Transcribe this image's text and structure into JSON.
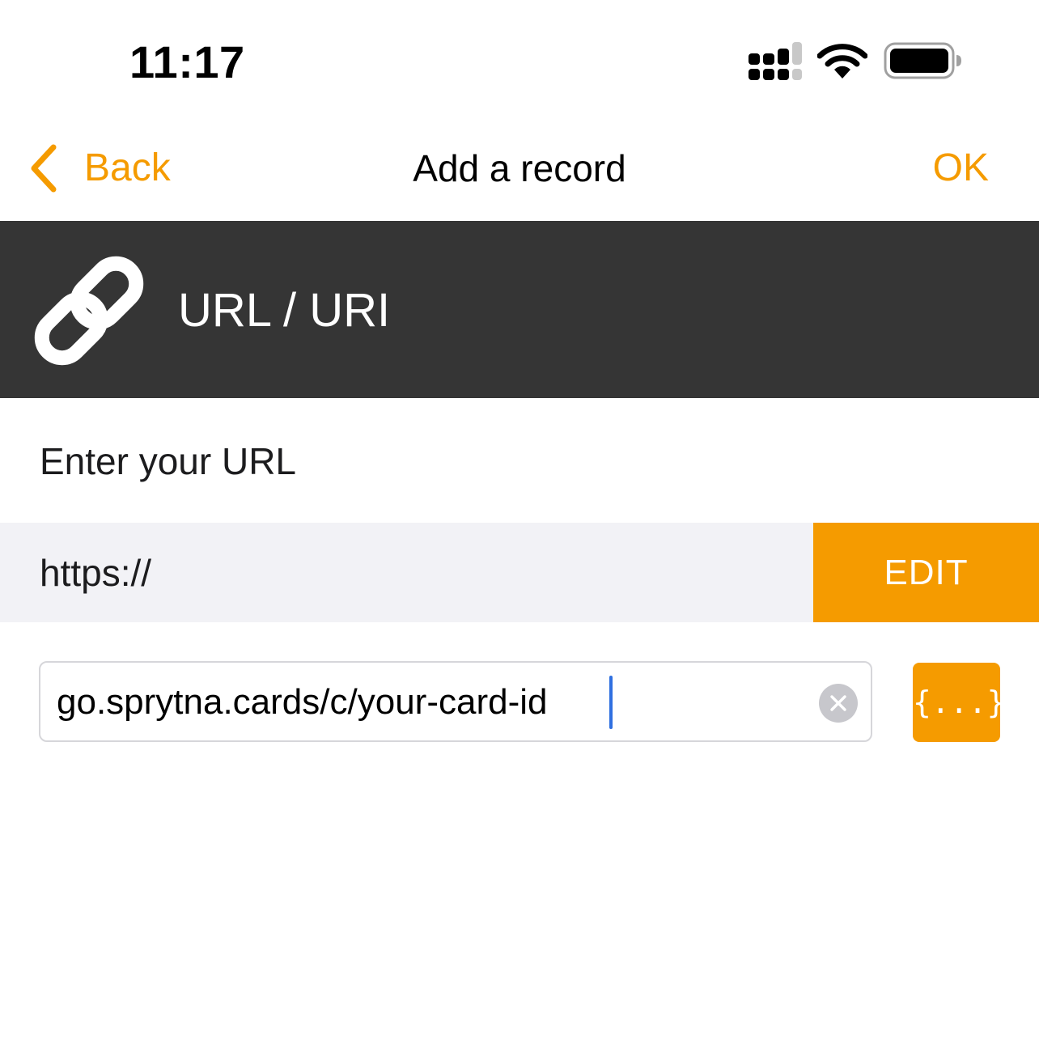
{
  "status_bar": {
    "time": "11:17",
    "signal_icon": "cellular-signal-icon",
    "wifi_icon": "wifi-icon",
    "battery_icon": "battery-icon"
  },
  "nav": {
    "back_label": "Back",
    "title": "Add a record",
    "ok_label": "OK"
  },
  "record_type": {
    "icon": "link-icon",
    "title": "URL / URI"
  },
  "form": {
    "prompt": "Enter your URL",
    "scheme": "https://",
    "edit_label": "EDIT",
    "url_value": "go.sprytna.cards/c/your-card-id",
    "variables_label": "{...}"
  },
  "colors": {
    "accent": "#F59B00",
    "header_background": "#353535",
    "scheme_row_background": "#F2F2F6",
    "cursor": "#2f6fe0"
  }
}
